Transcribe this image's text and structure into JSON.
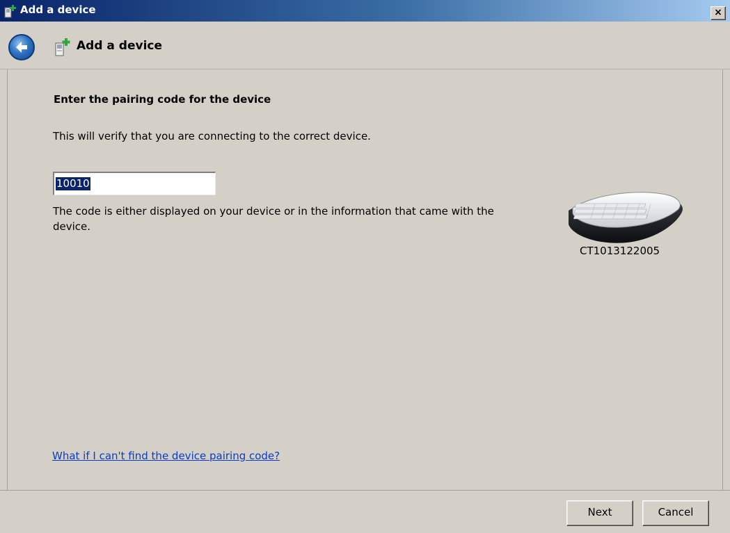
{
  "window": {
    "title": "Add a device",
    "close_label": "×"
  },
  "header": {
    "title": "Add a device"
  },
  "content": {
    "heading": "Enter the pairing code for the device",
    "subtext": "This will verify that you are connecting to the correct device.",
    "code_input": {
      "value": "10010"
    },
    "hint": "The code is either displayed on your device or in the information that came with the device.",
    "device": {
      "name": "CT1013122005",
      "icon": "keyboard-icon"
    },
    "help_link": "What if I can't find the device pairing code?"
  },
  "footer": {
    "next_label": "Next",
    "cancel_label": "Cancel"
  },
  "colors": {
    "titlebar_start": "#0a246a",
    "titlebar_end": "#a6caf0",
    "dialog_bg": "#d4d0c8",
    "link": "#0a3cc8",
    "selection": "#0a246a"
  }
}
